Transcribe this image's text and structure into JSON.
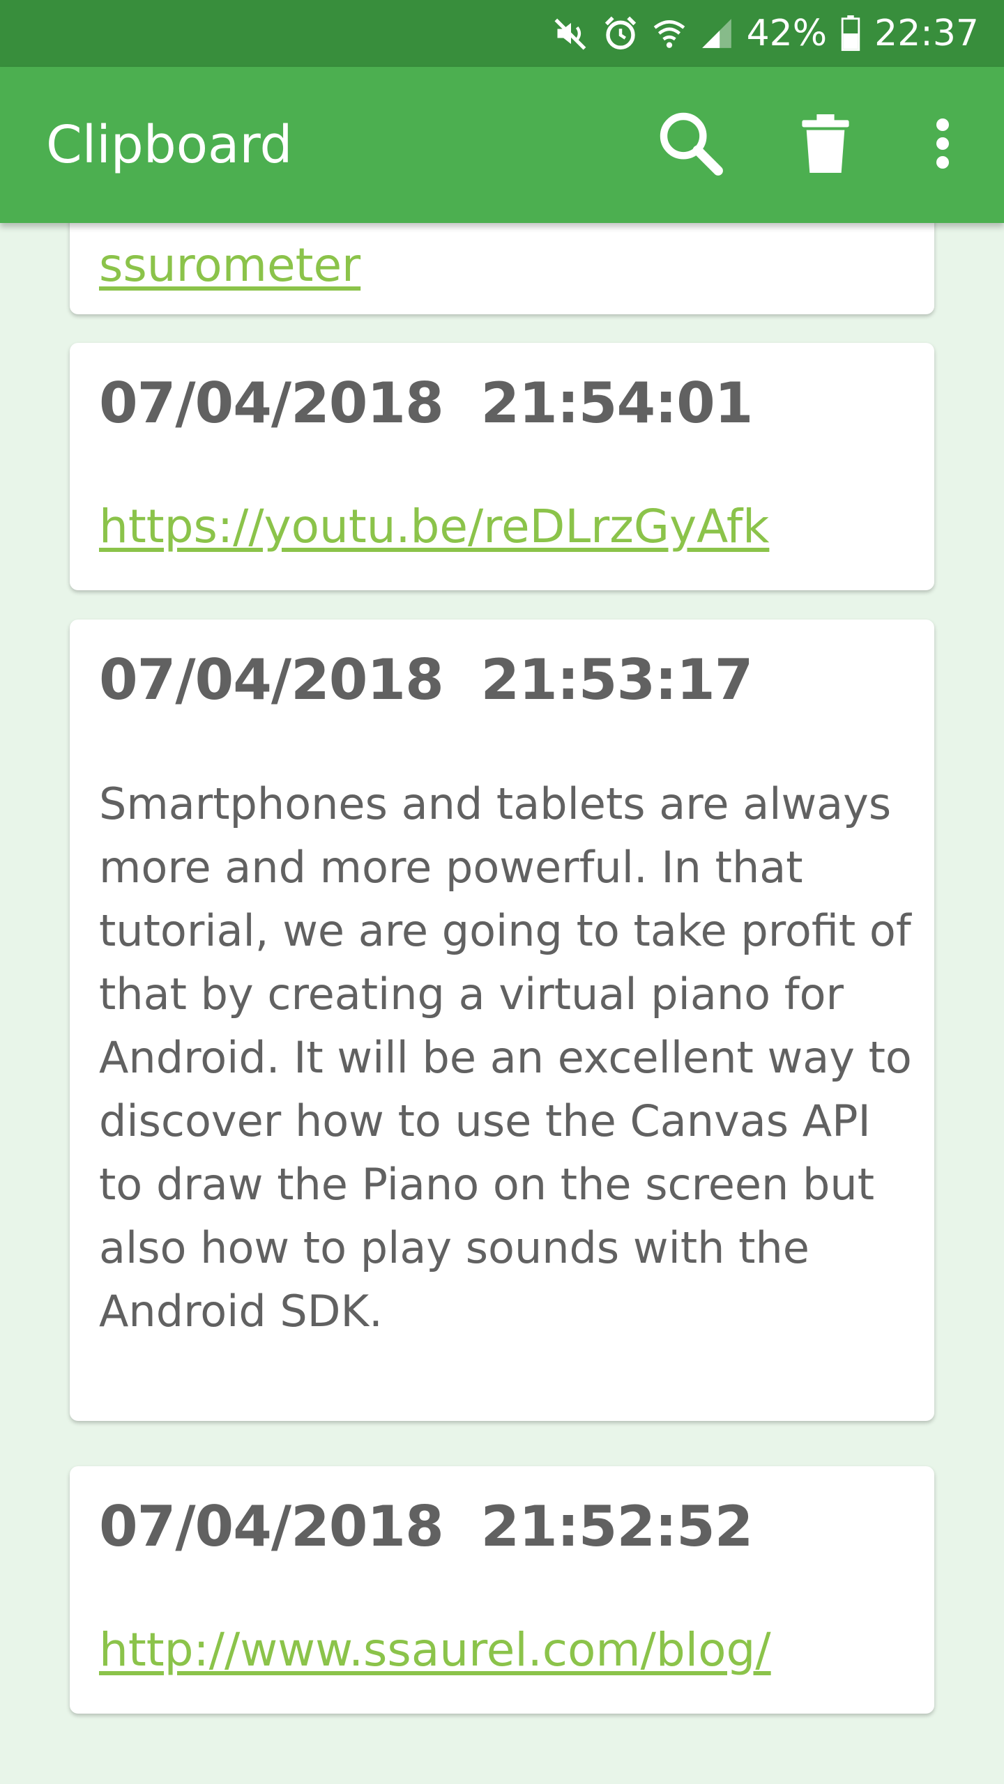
{
  "status_bar": {
    "battery": "42%",
    "time": "22:37",
    "icons": [
      "mute-icon",
      "alarm-icon",
      "wifi-icon",
      "signal-icon",
      "battery-icon"
    ]
  },
  "app_bar": {
    "title": "Clipboard",
    "actions": [
      "search-icon",
      "delete-icon",
      "more-vert-icon"
    ]
  },
  "clips": [
    {
      "date": "",
      "content": "ssurometer",
      "type": "link"
    },
    {
      "date": "07/04/2018  21:54:01",
      "content": "https://youtu.be/reDLrzGyAfk",
      "type": "link"
    },
    {
      "date": "07/04/2018  21:53:17",
      "content": "Smartphones and tablets are always more and more powerful. In that tutorial, we are going to take profit of that by creating a virtual piano for Android. It will be an excellent way to discover how to use the Canvas API to draw the Piano on the screen but also how to play sounds with the Android SDK.",
      "type": "text"
    },
    {
      "date": "07/04/2018  21:52:52",
      "content": "http://www.ssaurel.com/blog/",
      "type": "link"
    }
  ],
  "colors": {
    "status_bar": "#388e3c",
    "app_bar": "#4caf50",
    "background": "#e8f5e9",
    "link": "#8bc34a",
    "text": "#616161"
  }
}
